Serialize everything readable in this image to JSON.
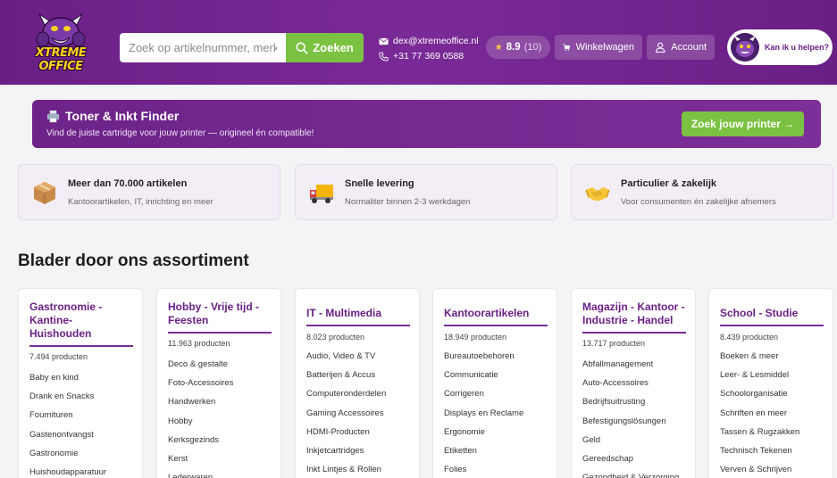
{
  "header": {
    "logo_text": "XTREME OFFICE",
    "search": {
      "placeholder": "Zoek op artikelnummer, merknaam",
      "button_label": "Zoeken"
    },
    "contact": {
      "email": "dex@xtremeoffice.nl",
      "phone": "+31 77 369 0588"
    },
    "rating": {
      "score": "8.9",
      "count": "(10)"
    },
    "cart_label": "Winkelwagen",
    "account_label": "Account",
    "help_label": "Kan ik u helpen?"
  },
  "toner": {
    "title": "Toner & Inkt Finder",
    "subtitle": "Vind de juiste cartridge voor jouw printer — origineel én compatible!",
    "button_label": "Zoek jouw printer →"
  },
  "features": [
    {
      "title": "Meer dan 70.000 artikelen",
      "desc": "Kantoorartikelen, IT, inrichting en meer",
      "icon": "box-icon"
    },
    {
      "title": "Snelle levering",
      "desc": "Normaliter binnen 2-3 werkdagen",
      "icon": "truck-icon"
    },
    {
      "title": "Particulier & zakelijk",
      "desc": "Voor consumenten én zakelijke afnemers",
      "icon": "handshake-icon"
    }
  ],
  "section_title": "Blader door ons assortiment",
  "categories": [
    {
      "title": "Gastronomie - Kantine- Huishouden",
      "count": "7.494 producten",
      "items": [
        "Baby en kind",
        "Drank en Snacks",
        "Fournituren",
        "Gastenontvangst",
        "Gastronomie",
        "Huishoudapparatuur"
      ]
    },
    {
      "title": "Hobby - Vrije tijd - Feesten",
      "count": "11.963 producten",
      "items": [
        "Deco & gestalte",
        "Foto-Accessoires",
        "Handwerken",
        "Hobby",
        "Kerksgezinds",
        "Kerst",
        "Lederwaren"
      ]
    },
    {
      "title": "IT - Multimedia",
      "count": "8.023 producten",
      "items": [
        "Audio, Video & TV",
        "Batterijen & Accus",
        "Computeronderdelen",
        "Gaming Accessoires",
        "HDMI-Producten",
        "Inkjetcartridges",
        "Inkt Lintjes & Rollen"
      ]
    },
    {
      "title": "Kantoorartikelen",
      "count": "18.949 producten",
      "items": [
        "Bureautoebehoren",
        "Communicatie",
        "Corrigeren",
        "Displays en Reclame",
        "Ergonomie",
        "Etiketten",
        "Folies"
      ]
    },
    {
      "title": "Magazijn - Kantoor - Industrie - Handel",
      "count": "13.717 producten",
      "items": [
        "Abfallmanagement",
        "Auto-Accessoires",
        "Bedrijfsuitrusting",
        "Befestigungslösungen",
        "Geld",
        "Gereedschap",
        "Gezondheid & Verzorging"
      ]
    },
    {
      "title": "School - Studie",
      "count": "8.439 producten",
      "items": [
        "Boeken & meer",
        "Leer- & Lesmiddel",
        "Schoolorganisatie",
        "Schriften en meer",
        "Tassen & Rugzakken",
        "Technisch Tekenen",
        "Verven & Schrijven"
      ]
    }
  ]
}
